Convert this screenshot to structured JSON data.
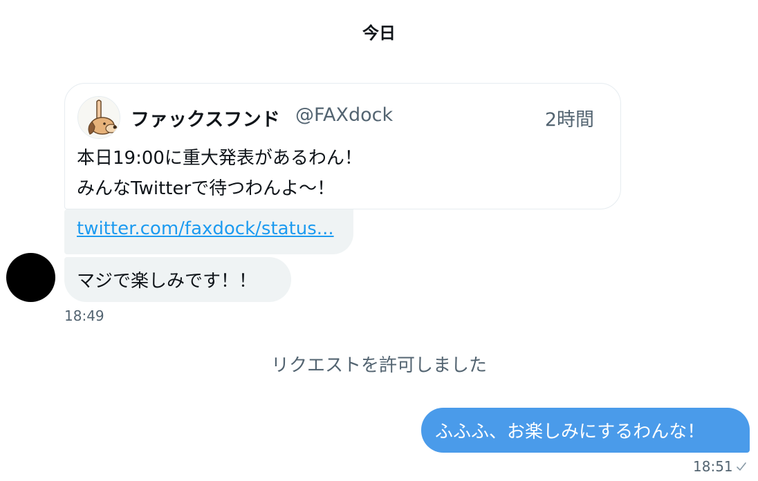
{
  "conversation": {
    "day_label": "今日",
    "shared_tweet": {
      "author_name": "ファックスフンド",
      "author_handle": "@FAXdock",
      "time_ago": "2時間",
      "text_line1": "本日19:00に重大発表があるわん！",
      "text_line2": "みんなTwitterで待つわんよ〜！"
    },
    "link_message": {
      "url_text": "twitter.com/faxdock/status..."
    },
    "received_message": {
      "text": "マジで楽しみです！！",
      "time": "18:49"
    },
    "system_message": "リクエストを許可しました",
    "sent_message": {
      "text": "ふふふ、お楽しみにするわんな！",
      "time": "18:51"
    },
    "colors": {
      "accent": "#4a9bea",
      "link": "#1d9bf0",
      "bubble_gray": "#eff3f4",
      "muted_text": "#536471"
    }
  }
}
